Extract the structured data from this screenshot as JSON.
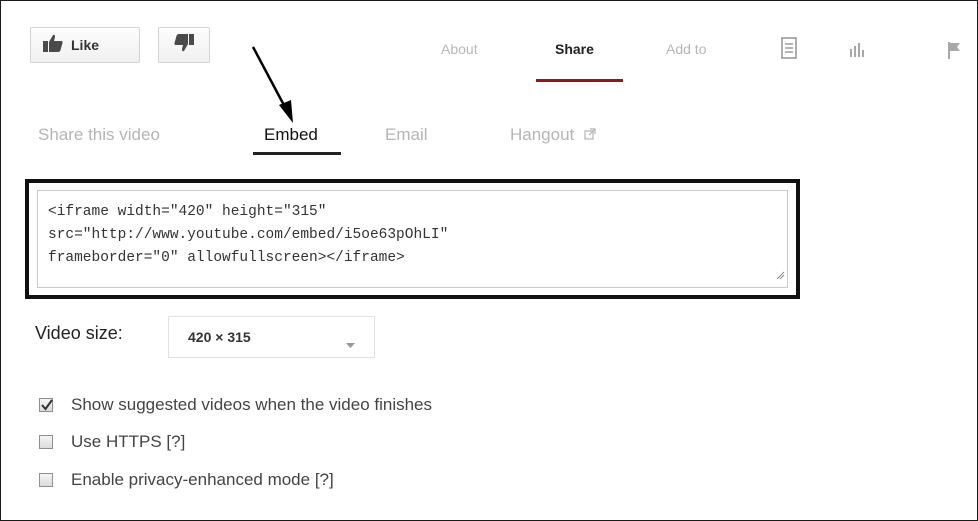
{
  "actions": {
    "like_label": "Like",
    "like_icon": "thumbs-up-icon",
    "dislike_icon": "thumbs-down-icon"
  },
  "top_tabs": [
    {
      "label": "About",
      "active": false
    },
    {
      "label": "Share",
      "active": true
    },
    {
      "label": "Add to",
      "active": false
    }
  ],
  "top_icons": [
    "transcript-icon",
    "stats-icon",
    "flag-icon"
  ],
  "share_tabs": [
    {
      "label": "Share this video",
      "active": false
    },
    {
      "label": "Embed",
      "active": true
    },
    {
      "label": "Email",
      "active": false
    },
    {
      "label": "Hangout",
      "active": false,
      "icon": "external-link-icon"
    }
  ],
  "embed": {
    "code": "<iframe width=\"420\" height=\"315\"\nsrc=\"http://www.youtube.com/embed/i5oe63pOhLI\"\nframeborder=\"0\" allowfullscreen></iframe>"
  },
  "video_size": {
    "label": "Video size:",
    "selected": "420 × 315"
  },
  "options": [
    {
      "label": "Show suggested videos when the video finishes",
      "checked": true
    },
    {
      "label": "Use HTTPS [?]",
      "checked": false
    },
    {
      "label": "Enable privacy-enhanced mode [?]",
      "checked": false
    }
  ],
  "colors": {
    "share_underline": "#8b1a1a",
    "highlight_border": "#111111"
  }
}
